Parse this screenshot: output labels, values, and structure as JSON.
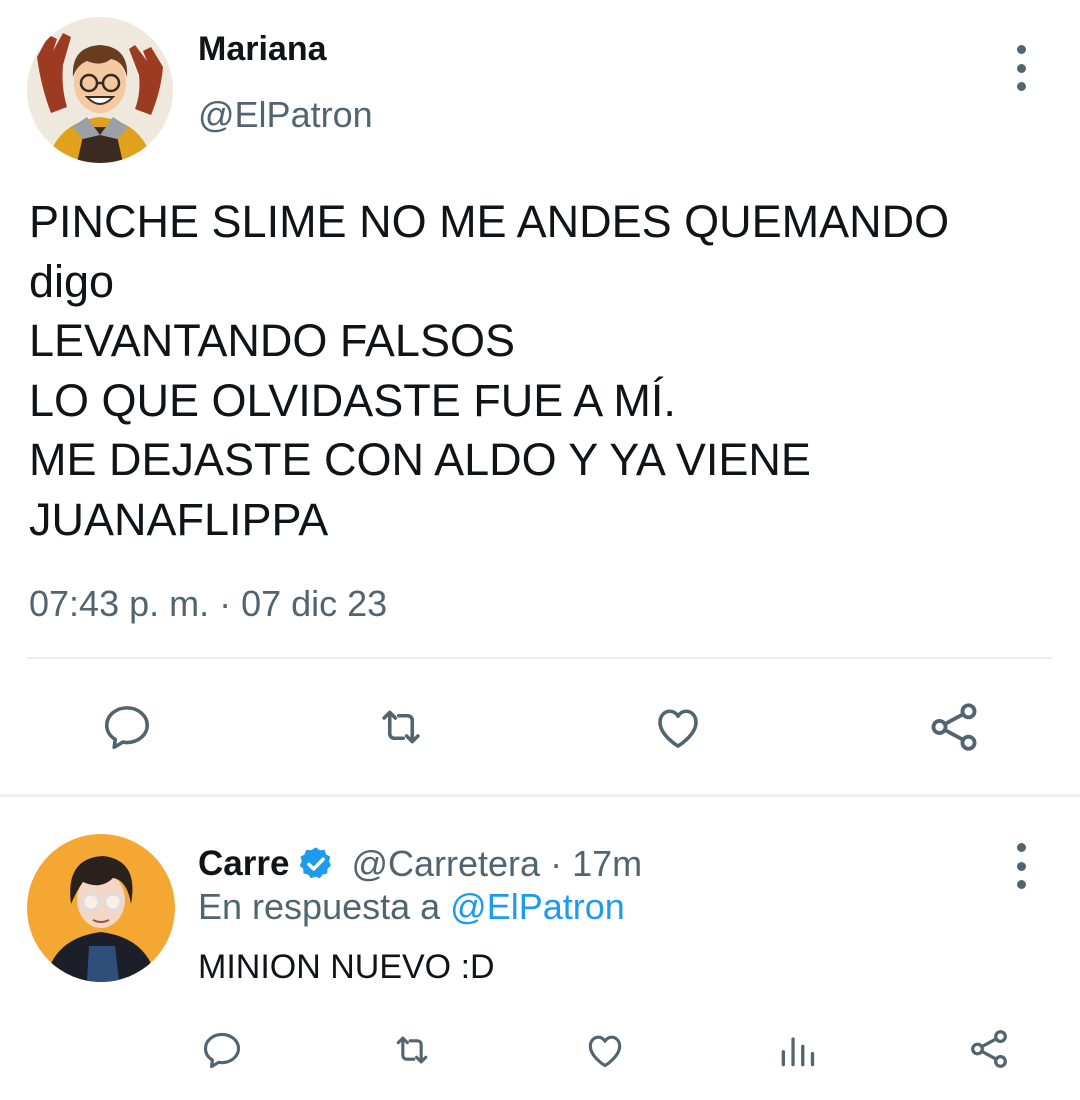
{
  "main_tweet": {
    "author_name": "Mariana",
    "author_handle": "@ElPatron",
    "avatar": "cartoon-avatar-peace-signs",
    "lines": [
      "PINCHE SLIME NO ME ANDES QUEMANDO",
      "digo",
      "LEVANTANDO FALSOS",
      "LO QUE OLVIDASTE FUE A MÍ.",
      "ME DEJASTE CON ALDO Y YA VIENE",
      "JUANAFLIPPA"
    ],
    "timestamp": "07:43 p. m. · 07 dic 23",
    "actions": [
      "reply-icon",
      "retweet-icon",
      "like-icon",
      "share-icon"
    ]
  },
  "reply_tweet": {
    "author_name": "Carre",
    "verified": true,
    "author_handle": "@Carretera",
    "separator": "·",
    "time": "17m",
    "reply_prefix": "En respuesta a ",
    "reply_to": "@ElPatron",
    "text": "MINION NUEVO :D",
    "avatar": "cartoon-avatar-glasses",
    "actions": [
      "reply-icon",
      "retweet-icon",
      "like-icon",
      "analytics-icon",
      "share-icon"
    ]
  },
  "colors": {
    "text_primary": "#0f1419",
    "text_secondary": "#536471",
    "link": "#1d9bf0",
    "icon": "#536471",
    "divider": "#e6ecf0"
  }
}
